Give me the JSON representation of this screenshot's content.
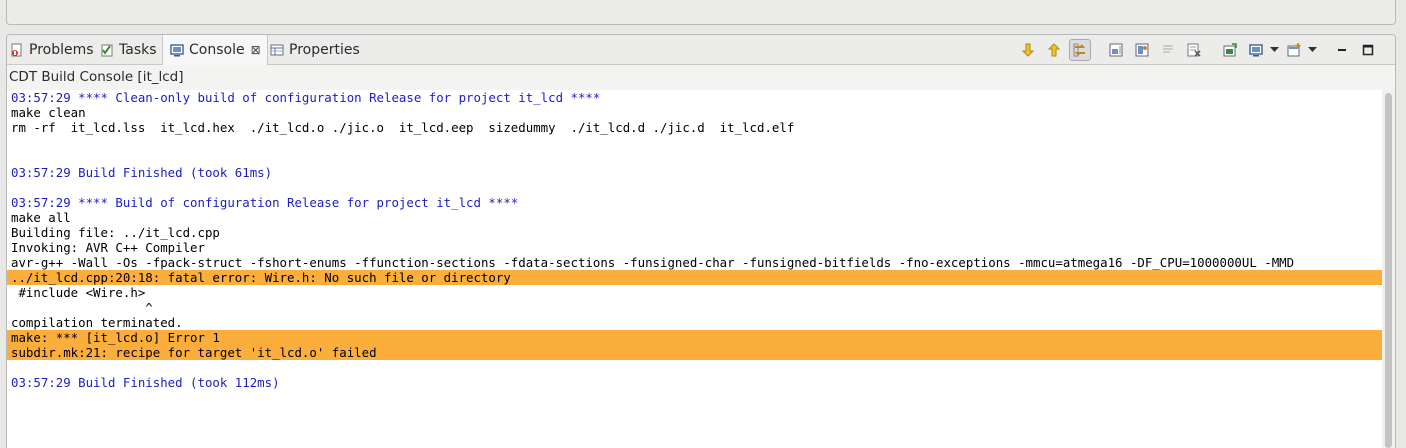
{
  "tabs": [
    {
      "label": "Problems",
      "icon": "problems-icon"
    },
    {
      "label": "Tasks",
      "icon": "tasks-icon"
    },
    {
      "label": "Console",
      "icon": "console-icon",
      "active": true,
      "close": "⊠"
    },
    {
      "label": "Properties",
      "icon": "properties-icon"
    }
  ],
  "toolbar": {
    "icons": [
      "next-annotation-icon",
      "previous-annotation-icon",
      "link-with-editor-icon",
      "scroll-lock-icon",
      "pin-console-icon",
      "word-wrap-icon",
      "clear-console-icon",
      "open-console-icon",
      "display-selected-console-icon",
      "new-console-icon",
      "minimize-icon",
      "maximize-icon"
    ]
  },
  "console": {
    "title": "CDT Build Console [it_lcd]",
    "lines": [
      {
        "text": "03:57:29 **** Clean-only build of configuration Release for project it_lcd ****",
        "type": "info"
      },
      {
        "text": "make clean",
        "type": "normal"
      },
      {
        "text": "rm -rf  it_lcd.lss  it_lcd.hex  ./it_lcd.o ./jic.o  it_lcd.eep  sizedummy  ./it_lcd.d ./jic.d  it_lcd.elf",
        "type": "normal"
      },
      {
        "text": "",
        "type": "normal"
      },
      {
        "text": "",
        "type": "normal"
      },
      {
        "text": "03:57:29 Build Finished (took 61ms)",
        "type": "info"
      },
      {
        "text": "",
        "type": "normal"
      },
      {
        "text": "03:57:29 **** Build of configuration Release for project it_lcd ****",
        "type": "info"
      },
      {
        "text": "make all",
        "type": "normal"
      },
      {
        "text": "Building file: ../it_lcd.cpp",
        "type": "normal"
      },
      {
        "text": "Invoking: AVR C++ Compiler",
        "type": "normal"
      },
      {
        "text": "avr-g++ -Wall -Os -fpack-struct -fshort-enums -ffunction-sections -fdata-sections -funsigned-char -funsigned-bitfields -fno-exceptions -mmcu=atmega16 -DF_CPU=1000000UL -MMD",
        "type": "normal"
      },
      {
        "text": "../it_lcd.cpp:20:18: fatal error: Wire.h: No such file or directory",
        "type": "error"
      },
      {
        "text": " #include <Wire.h>",
        "type": "normal"
      },
      {
        "text": "                  ^",
        "type": "normal"
      },
      {
        "text": "compilation terminated.",
        "type": "normal"
      },
      {
        "text": "make: *** [it_lcd.o] Error 1",
        "type": "error"
      },
      {
        "text": "subdir.mk:21: recipe for target 'it_lcd.o' failed",
        "type": "error"
      },
      {
        "text": "",
        "type": "normal"
      },
      {
        "text": "03:57:29 Build Finished (took 112ms)",
        "type": "info"
      }
    ]
  },
  "colors": {
    "info_text": "#1d1dc4",
    "error_highlight": "#fbae3c"
  }
}
